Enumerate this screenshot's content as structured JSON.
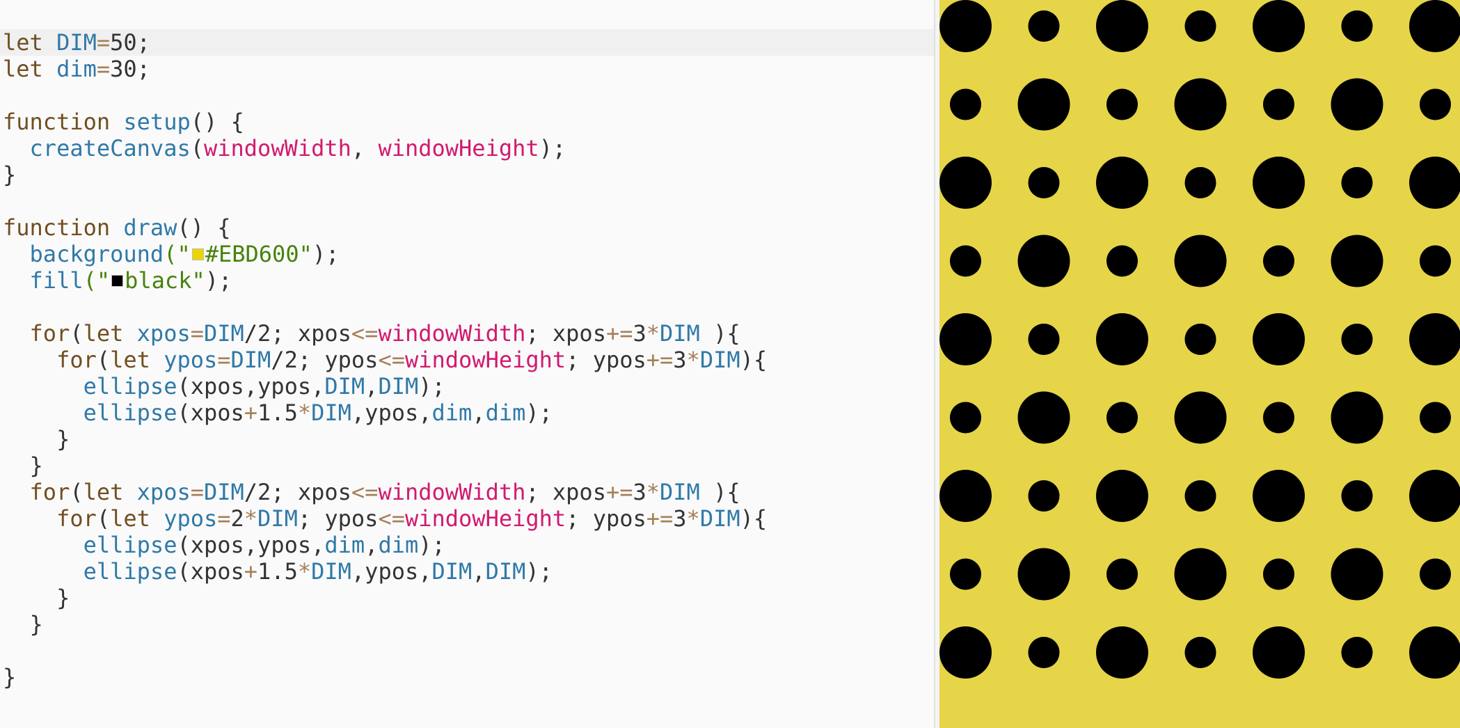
{
  "editor": {
    "active_line": 0,
    "lines": [
      [
        {
          "t": "kw",
          "s": "let "
        },
        {
          "t": "var",
          "s": "DIM"
        },
        {
          "t": "op",
          "s": "="
        },
        {
          "t": "num",
          "s": "50"
        },
        {
          "t": "plain",
          "s": ";"
        }
      ],
      [
        {
          "t": "kw",
          "s": "let "
        },
        {
          "t": "var",
          "s": "dim"
        },
        {
          "t": "op",
          "s": "="
        },
        {
          "t": "num",
          "s": "30"
        },
        {
          "t": "plain",
          "s": ";"
        }
      ],
      [],
      [
        {
          "t": "kw",
          "s": "function "
        },
        {
          "t": "fn",
          "s": "setup"
        },
        {
          "t": "plain",
          "s": "() {"
        }
      ],
      [
        {
          "t": "plain",
          "s": "  "
        },
        {
          "t": "fn",
          "s": "createCanvas"
        },
        {
          "t": "plain",
          "s": "("
        },
        {
          "t": "builtin",
          "s": "windowWidth"
        },
        {
          "t": "plain",
          "s": ", "
        },
        {
          "t": "builtin",
          "s": "windowHeight"
        },
        {
          "t": "plain",
          "s": ");"
        }
      ],
      [
        {
          "t": "plain",
          "s": "}"
        }
      ],
      [],
      [
        {
          "t": "kw",
          "s": "function "
        },
        {
          "t": "fn",
          "s": "draw"
        },
        {
          "t": "plain",
          "s": "() {"
        }
      ],
      [
        {
          "t": "plain",
          "s": "  "
        },
        {
          "t": "fn",
          "s": "background"
        },
        {
          "t": "str",
          "s": "(\""
        },
        {
          "t": "swatch",
          "s": "#EBD600"
        },
        {
          "t": "str",
          "s": "#EBD600\""
        },
        {
          "t": "plain",
          "s": ");"
        }
      ],
      [
        {
          "t": "plain",
          "s": "  "
        },
        {
          "t": "fn",
          "s": "fill"
        },
        {
          "t": "str",
          "s": "(\""
        },
        {
          "t": "swatch",
          "s": "#000000"
        },
        {
          "t": "str",
          "s": "black\""
        },
        {
          "t": "plain",
          "s": ");"
        }
      ],
      [],
      [
        {
          "t": "plain",
          "s": "  "
        },
        {
          "t": "kw",
          "s": "for"
        },
        {
          "t": "plain",
          "s": "("
        },
        {
          "t": "kw",
          "s": "let "
        },
        {
          "t": "var",
          "s": "xpos"
        },
        {
          "t": "op",
          "s": "="
        },
        {
          "t": "var",
          "s": "DIM"
        },
        {
          "t": "plain",
          "s": "/2; xpos"
        },
        {
          "t": "op",
          "s": "<="
        },
        {
          "t": "builtin",
          "s": "windowWidth"
        },
        {
          "t": "plain",
          "s": "; xpos"
        },
        {
          "t": "op",
          "s": "+="
        },
        {
          "t": "plain",
          "s": "3"
        },
        {
          "t": "op",
          "s": "*"
        },
        {
          "t": "var",
          "s": "DIM"
        },
        {
          "t": "plain",
          "s": " ){"
        }
      ],
      [
        {
          "t": "plain",
          "s": "    "
        },
        {
          "t": "kw",
          "s": "for"
        },
        {
          "t": "plain",
          "s": "("
        },
        {
          "t": "kw",
          "s": "let "
        },
        {
          "t": "var",
          "s": "ypos"
        },
        {
          "t": "op",
          "s": "="
        },
        {
          "t": "var",
          "s": "DIM"
        },
        {
          "t": "plain",
          "s": "/2; ypos"
        },
        {
          "t": "op",
          "s": "<="
        },
        {
          "t": "builtin",
          "s": "windowHeight"
        },
        {
          "t": "plain",
          "s": "; ypos"
        },
        {
          "t": "op",
          "s": "+="
        },
        {
          "t": "plain",
          "s": "3"
        },
        {
          "t": "op",
          "s": "*"
        },
        {
          "t": "var",
          "s": "DIM"
        },
        {
          "t": "plain",
          "s": "){"
        }
      ],
      [
        {
          "t": "plain",
          "s": "      "
        },
        {
          "t": "fn",
          "s": "ellipse"
        },
        {
          "t": "plain",
          "s": "(xpos,ypos,"
        },
        {
          "t": "var",
          "s": "DIM"
        },
        {
          "t": "plain",
          "s": ","
        },
        {
          "t": "var",
          "s": "DIM"
        },
        {
          "t": "plain",
          "s": ");"
        }
      ],
      [
        {
          "t": "plain",
          "s": "      "
        },
        {
          "t": "fn",
          "s": "ellipse"
        },
        {
          "t": "plain",
          "s": "(xpos"
        },
        {
          "t": "op",
          "s": "+"
        },
        {
          "t": "plain",
          "s": "1.5"
        },
        {
          "t": "op",
          "s": "*"
        },
        {
          "t": "var",
          "s": "DIM"
        },
        {
          "t": "plain",
          "s": ",ypos,"
        },
        {
          "t": "var",
          "s": "dim"
        },
        {
          "t": "plain",
          "s": ","
        },
        {
          "t": "var",
          "s": "dim"
        },
        {
          "t": "plain",
          "s": ");"
        }
      ],
      [
        {
          "t": "plain",
          "s": "    }"
        }
      ],
      [
        {
          "t": "plain",
          "s": "  }"
        }
      ],
      [
        {
          "t": "plain",
          "s": "  "
        },
        {
          "t": "kw",
          "s": "for"
        },
        {
          "t": "plain",
          "s": "("
        },
        {
          "t": "kw",
          "s": "let "
        },
        {
          "t": "var",
          "s": "xpos"
        },
        {
          "t": "op",
          "s": "="
        },
        {
          "t": "var",
          "s": "DIM"
        },
        {
          "t": "plain",
          "s": "/2; xpos"
        },
        {
          "t": "op",
          "s": "<="
        },
        {
          "t": "builtin",
          "s": "windowWidth"
        },
        {
          "t": "plain",
          "s": "; xpos"
        },
        {
          "t": "op",
          "s": "+="
        },
        {
          "t": "plain",
          "s": "3"
        },
        {
          "t": "op",
          "s": "*"
        },
        {
          "t": "var",
          "s": "DIM"
        },
        {
          "t": "plain",
          "s": " ){"
        }
      ],
      [
        {
          "t": "plain",
          "s": "    "
        },
        {
          "t": "kw",
          "s": "for"
        },
        {
          "t": "plain",
          "s": "("
        },
        {
          "t": "kw",
          "s": "let "
        },
        {
          "t": "var",
          "s": "ypos"
        },
        {
          "t": "op",
          "s": "="
        },
        {
          "t": "plain",
          "s": "2"
        },
        {
          "t": "op",
          "s": "*"
        },
        {
          "t": "var",
          "s": "DIM"
        },
        {
          "t": "plain",
          "s": "; ypos"
        },
        {
          "t": "op",
          "s": "<="
        },
        {
          "t": "builtin",
          "s": "windowHeight"
        },
        {
          "t": "plain",
          "s": "; ypos"
        },
        {
          "t": "op",
          "s": "+="
        },
        {
          "t": "plain",
          "s": "3"
        },
        {
          "t": "op",
          "s": "*"
        },
        {
          "t": "var",
          "s": "DIM"
        },
        {
          "t": "plain",
          "s": "){"
        }
      ],
      [
        {
          "t": "plain",
          "s": "      "
        },
        {
          "t": "fn",
          "s": "ellipse"
        },
        {
          "t": "plain",
          "s": "(xpos,ypos,"
        },
        {
          "t": "var",
          "s": "dim"
        },
        {
          "t": "plain",
          "s": ","
        },
        {
          "t": "var",
          "s": "dim"
        },
        {
          "t": "plain",
          "s": ");"
        }
      ],
      [
        {
          "t": "plain",
          "s": "      "
        },
        {
          "t": "fn",
          "s": "ellipse"
        },
        {
          "t": "plain",
          "s": "(xpos"
        },
        {
          "t": "op",
          "s": "+"
        },
        {
          "t": "plain",
          "s": "1.5"
        },
        {
          "t": "op",
          "s": "*"
        },
        {
          "t": "var",
          "s": "DIM"
        },
        {
          "t": "plain",
          "s": ",ypos,"
        },
        {
          "t": "var",
          "s": "DIM"
        },
        {
          "t": "plain",
          "s": ","
        },
        {
          "t": "var",
          "s": "DIM"
        },
        {
          "t": "plain",
          "s": ");"
        }
      ],
      [
        {
          "t": "plain",
          "s": "    }"
        }
      ],
      [
        {
          "t": "plain",
          "s": "  }"
        }
      ],
      [],
      [
        {
          "t": "plain",
          "s": "}"
        }
      ]
    ]
  },
  "preview": {
    "background": "#E6D548",
    "fill": "#000000",
    "DIM": 50,
    "dim": 30,
    "scale": 1.5,
    "canvas_width": 498,
    "canvas_height": 697
  }
}
